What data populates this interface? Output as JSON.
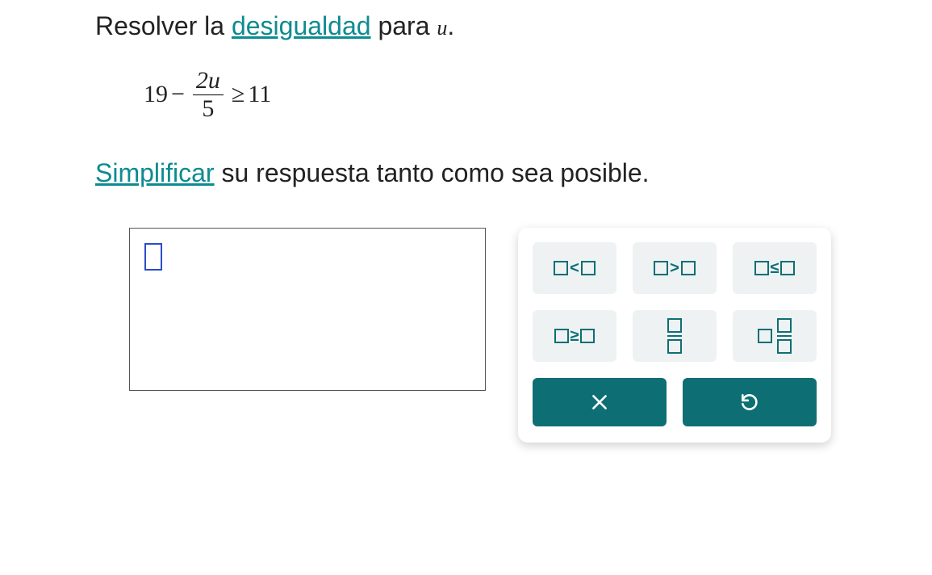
{
  "line1_pre": "Resolver la ",
  "line1_link": "desigualdad",
  "line1_post": " para ",
  "line1_var": "u",
  "line1_end": ".",
  "expr": {
    "lhs_const": "19",
    "minus": "−",
    "num": "2u",
    "den": "5",
    "rel": "≥",
    "rhs": "11"
  },
  "line2_link": "Simplificar",
  "line2_post": " su respuesta tanto como sea posible.",
  "ops": {
    "lt": "<",
    "gt": ">",
    "le": "≤",
    "ge": "≥"
  }
}
